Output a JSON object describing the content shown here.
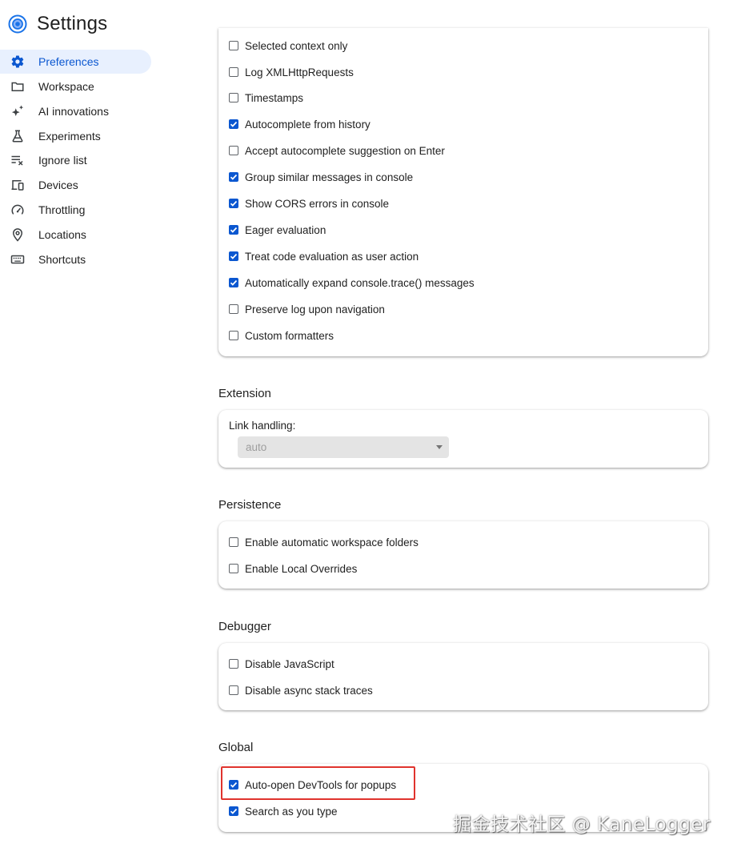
{
  "header": {
    "title": "Settings"
  },
  "sidebar": {
    "items": [
      {
        "label": "Preferences",
        "icon": "gear-icon",
        "active": true
      },
      {
        "label": "Workspace",
        "icon": "folder-icon"
      },
      {
        "label": "AI innovations",
        "icon": "sparkle-icon"
      },
      {
        "label": "Experiments",
        "icon": "flask-icon"
      },
      {
        "label": "Ignore list",
        "icon": "ignore-list-icon"
      },
      {
        "label": "Devices",
        "icon": "devices-icon"
      },
      {
        "label": "Throttling",
        "icon": "speedometer-icon"
      },
      {
        "label": "Locations",
        "icon": "location-pin-icon"
      },
      {
        "label": "Shortcuts",
        "icon": "keyboard-icon"
      }
    ]
  },
  "console_options": [
    {
      "label": "Selected context only",
      "checked": false
    },
    {
      "label": "Log XMLHttpRequests",
      "checked": false
    },
    {
      "label": "Timestamps",
      "checked": false
    },
    {
      "label": "Autocomplete from history",
      "checked": true
    },
    {
      "label": "Accept autocomplete suggestion on Enter",
      "checked": false
    },
    {
      "label": "Group similar messages in console",
      "checked": true
    },
    {
      "label": "Show CORS errors in console",
      "checked": true
    },
    {
      "label": "Eager evaluation",
      "checked": true
    },
    {
      "label": "Treat code evaluation as user action",
      "checked": true
    },
    {
      "label": "Automatically expand console.trace() messages",
      "checked": true
    },
    {
      "label": "Preserve log upon navigation",
      "checked": false
    },
    {
      "label": "Custom formatters",
      "checked": false
    }
  ],
  "extension": {
    "title": "Extension",
    "link_handling_label": "Link handling:",
    "link_handling_value": "auto"
  },
  "persistence": {
    "title": "Persistence",
    "options": [
      {
        "label": "Enable automatic workspace folders",
        "checked": false
      },
      {
        "label": "Enable Local Overrides",
        "checked": false
      }
    ]
  },
  "debugger": {
    "title": "Debugger",
    "options": [
      {
        "label": "Disable JavaScript",
        "checked": false
      },
      {
        "label": "Disable async stack traces",
        "checked": false
      }
    ]
  },
  "global": {
    "title": "Global",
    "options": [
      {
        "label": "Auto-open DevTools for popups",
        "checked": true
      },
      {
        "label": "Search as you type",
        "checked": true
      }
    ]
  },
  "watermark": "掘金技术社区 @ KaneLogger",
  "colors": {
    "accent": "#0b57d0",
    "active_bg": "#e8f0fe",
    "highlight_border": "#e0332d"
  }
}
